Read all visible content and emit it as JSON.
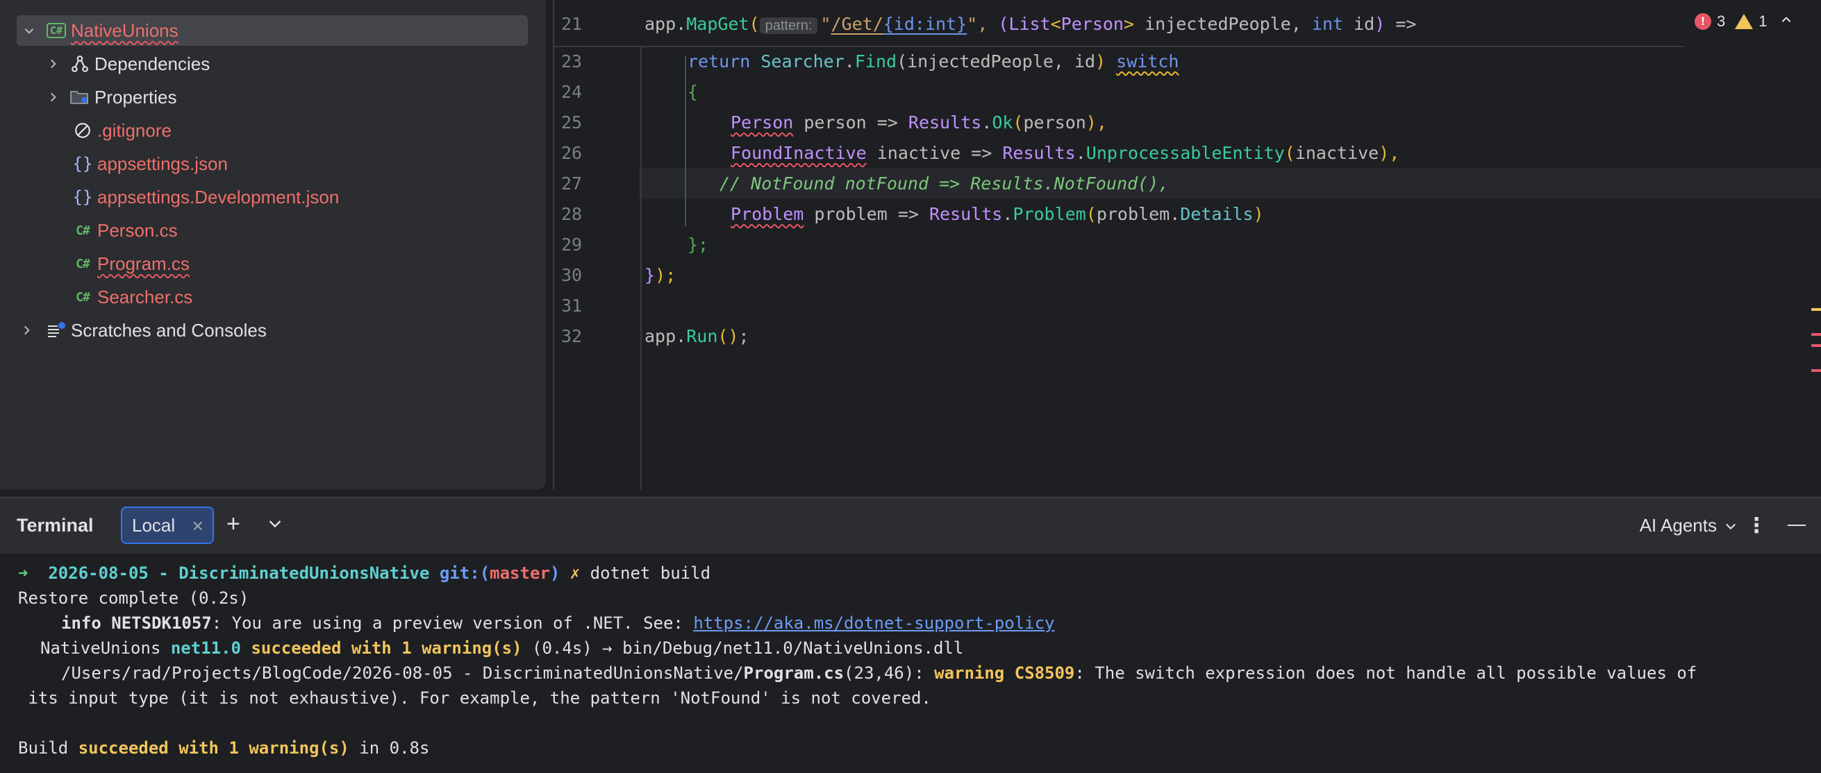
{
  "project_tree": {
    "root": "NativeUnions",
    "items": [
      {
        "label": "Dependencies",
        "icon": "dependencies-icon"
      },
      {
        "label": "Properties",
        "icon": "folder-settings-icon"
      },
      {
        "label": ".gitignore",
        "icon": "ignore-file-icon"
      },
      {
        "label": "appsettings.json",
        "icon": "json-braces-icon"
      },
      {
        "label": "appsettings.Development.json",
        "icon": "json-braces-icon"
      },
      {
        "label": "Person.cs",
        "icon": "csharp-file-icon"
      },
      {
        "label": "Program.cs",
        "icon": "csharp-file-icon"
      },
      {
        "label": "Searcher.cs",
        "icon": "csharp-file-icon"
      }
    ],
    "scratches": "Scratches and Consoles",
    "csharp_badge": "C#"
  },
  "editor": {
    "line_numbers": [
      "21",
      "23",
      "24",
      "25",
      "26",
      "27",
      "28",
      "29",
      "30",
      "31",
      "32"
    ],
    "param_hint": "pattern:",
    "inspections": {
      "errors": "3",
      "warnings": "1"
    },
    "code": {
      "l21_a": "app.",
      "l21_b": "MapGet",
      "l21_c": "(",
      "l21_d": "\"",
      "l21_e": "/Get/",
      "l21_f": "{id:int}",
      "l21_g": "\", ",
      "l21_h": "(",
      "l21_i": "List",
      "l21_j": "<",
      "l21_k": "Person",
      "l21_l": ">",
      "l21_m": " injectedPeople, ",
      "l21_n": "int",
      "l21_o": " id",
      "l21_p": ")",
      "l21_q": " =>",
      "l23_a": "return ",
      "l23_b": "Searcher",
      "l23_c": ".",
      "l23_d": "Find",
      "l23_e": "(injectedPeople, id",
      "l23_f": ")",
      "l23_g": " ",
      "l23_h": "switch",
      "l24": "{",
      "l25_a": "Person",
      "l25_b": " person => ",
      "l25_c": "Results",
      "l25_d": ".",
      "l25_e": "Ok",
      "l25_f": "(",
      "l25_g": "person",
      "l25_h": "),",
      "l26_a": "FoundInactive",
      "l26_b": " inactive => ",
      "l26_c": "Results",
      "l26_d": ".",
      "l26_e": "UnprocessableEntity",
      "l26_f": "(",
      "l26_g": "inactive",
      "l26_h": "),",
      "l27": "// NotFound notFound => Results.NotFound(),",
      "l28_a": "Problem",
      "l28_b": " problem => ",
      "l28_c": "Results",
      "l28_d": ".",
      "l28_e": "Problem",
      "l28_f": "(",
      "l28_g": "problem.",
      "l28_h": "Details",
      "l28_i": ")",
      "l29": "};",
      "l30_a": "}",
      "l30_b": ");",
      "l32_a": "app.",
      "l32_b": "Run",
      "l32_c": "()",
      "l32_d": ";"
    }
  },
  "terminal": {
    "title": "Terminal",
    "tab": "Local",
    "ai_agents": "AI Agents",
    "lines": {
      "prompt_arrow": "➜",
      "prompt_dir": "2026-08-05 - DiscriminatedUnionsNative",
      "prompt_git": "git:",
      "prompt_paren_open": "(",
      "prompt_branch": "master",
      "prompt_paren_close": ")",
      "prompt_x": "✗",
      "prompt_cmd": "dotnet build",
      "restore": "Restore complete (0.2s)",
      "info_label": "info NETSDK1057",
      "info_text": ": You are using a preview version of .NET. See: ",
      "info_link": "https://aka.ms/dotnet-support-policy",
      "proj_name": "NativeUnions ",
      "proj_tfm": "net11.0",
      "proj_status": " succeeded with 1 warning(s)",
      "proj_rest": " (0.4s) → bin/Debug/net11.0/NativeUnions.dll",
      "warn_path": "/Users/rad/Projects/BlogCode/2026-08-05 - DiscriminatedUnionsNative/",
      "warn_file": "Program.cs",
      "warn_pos": "(23,46): ",
      "warn_code": "warning CS8509",
      "warn_text": ": The switch expression does not handle all possible values of",
      "warn_text2": " its input type (it is not exhaustive). For example, the pattern 'NotFound' is not covered.",
      "build_a": "Build ",
      "build_b": "succeeded with 1 warning(s)",
      "build_c": " in 0.8s"
    }
  }
}
